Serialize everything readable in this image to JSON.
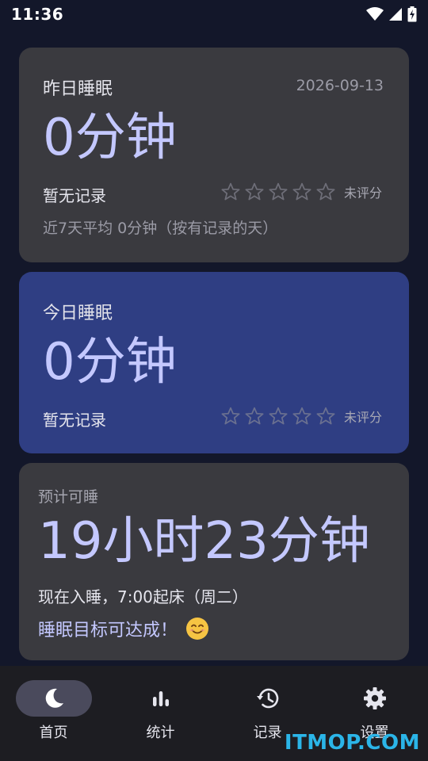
{
  "status_bar": {
    "time": "11:36"
  },
  "yesterday": {
    "title": "昨日睡眠",
    "date": "2026-09-13",
    "duration": "0分钟",
    "record": "暂无记录",
    "rating": 0,
    "rating_label": "未评分",
    "average": "近7天平均 0分钟（按有记录的天）"
  },
  "today": {
    "title": "今日睡眠",
    "duration": "0分钟",
    "record": "暂无记录",
    "rating": 0,
    "rating_label": "未评分"
  },
  "estimate": {
    "title": "预计可睡",
    "duration": "19小时23分钟",
    "wake": "现在入睡，7:00起床（周二）",
    "goal": "睡眠目标可达成！"
  },
  "nav": {
    "items": [
      {
        "label": "首页",
        "icon": "moon-icon",
        "active": true
      },
      {
        "label": "统计",
        "icon": "bar-chart-icon",
        "active": false
      },
      {
        "label": "记录",
        "icon": "history-icon",
        "active": false
      },
      {
        "label": "设置",
        "icon": "gear-icon",
        "active": false
      }
    ]
  },
  "watermark": "ITMOP.COM",
  "colors": {
    "background": "#13172a",
    "card_dark": "#3a3a3f",
    "card_blue": "#2f3e83",
    "accent": "#c4c8ff"
  }
}
